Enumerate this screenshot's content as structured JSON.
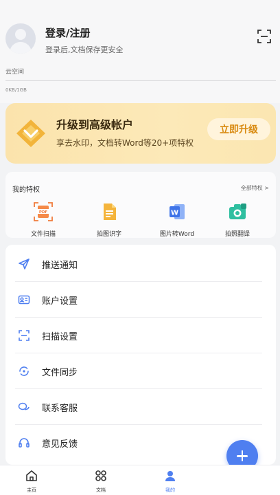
{
  "header": {
    "login_title": "登录/注册",
    "login_subtitle": "登录后,文档保存更安全",
    "space_label": "云空间",
    "space_value": "0KB/1GB"
  },
  "upgrade": {
    "title": "升级到高级帐户",
    "subtitle": "享去水印，文档转Word等20+项特权",
    "button": "立即升级"
  },
  "perks": {
    "title": "我的特权",
    "all_link": "全部特权 >",
    "items": [
      {
        "label": "文件扫描",
        "icon": "pdf-scan-icon"
      },
      {
        "label": "拍图识字",
        "icon": "ocr-document-icon"
      },
      {
        "label": "图片转Word",
        "icon": "word-icon"
      },
      {
        "label": "拍照翻译",
        "icon": "camera-translate-icon"
      }
    ]
  },
  "menu": [
    {
      "label": "推送通知",
      "icon": "send-icon"
    },
    {
      "label": "账户设置",
      "icon": "id-card-icon"
    },
    {
      "label": "扫描设置",
      "icon": "scan-frame-icon"
    },
    {
      "label": "文件同步",
      "icon": "sync-icon"
    },
    {
      "label": "联系客服",
      "icon": "chat-bubbles-icon"
    },
    {
      "label": "意见反馈",
      "icon": "headset-icon"
    }
  ],
  "tabs": [
    {
      "label": "主页",
      "icon": "home-icon",
      "active": false
    },
    {
      "label": "文档",
      "icon": "grid-icon",
      "active": false
    },
    {
      "label": "我的",
      "icon": "profile-icon",
      "active": true
    }
  ],
  "colors": {
    "accent": "#4f7ff0",
    "upgrade_bg": "#fbe3ac",
    "upgrade_button_text": "#d98a10"
  }
}
